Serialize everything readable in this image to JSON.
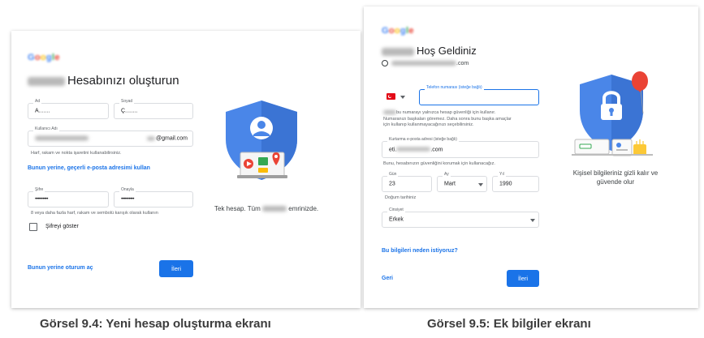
{
  "screen1": {
    "title": "Hesabınızı oluşturun",
    "first_name": {
      "label": "Ad",
      "value": "A......."
    },
    "last_name": {
      "label": "Soyad",
      "value": "Ç........"
    },
    "username": {
      "label": "Kullanıcı Adı",
      "suffix": "@gmail.com"
    },
    "username_hint": "Harf, rakam ve nokta işaretini kullanabilirsiniz.",
    "use_email_link": "Bunun yerine, geçerli e-posta adresimi kullan",
    "password": {
      "label": "Şifre",
      "value": "••••••••••"
    },
    "confirm": {
      "label": "Onayla",
      "value": "••••••••••"
    },
    "password_hint": "8 veya daha fazla harf, rakam ve sembolü karışık olarak kullanın",
    "show_password_label": "Şifreyi göster",
    "sign_in_link": "Bunun yerine oturum aç",
    "next_button": "İleri",
    "tagline_prefix": "Tek hesap. Tüm",
    "tagline_suffix": "emrinizde."
  },
  "screen2": {
    "title_suffix": "Hoş Geldiniz",
    "email_suffix": ".com",
    "phone": {
      "label": "Telefon numarası (isteğe bağlı)"
    },
    "phone_hint_lines": [
      "bu numarayı yalnızca hesap güvenliği için kullanır.",
      "Numaranızı başkaları göremez. Daha sonra bunu başka amaçlar",
      "için kullanıp kullanmayacağınızı seçebilirsiniz."
    ],
    "recovery": {
      "label": "Kurtarma e-posta adresi (isteğe bağlı)",
      "value_prefix": "eti.",
      "value_suffix": ".com"
    },
    "recovery_hint": "Bunu, hesabınızın güvenliğini korumak için kullanacağız.",
    "day": {
      "label": "Gün",
      "value": "23"
    },
    "month": {
      "label": "Ay",
      "value": "Mart"
    },
    "year": {
      "label": "Yıl",
      "value": "1990"
    },
    "birthday_label": "Doğum tarihiniz",
    "gender": {
      "label": "Cinsiyet",
      "value": "Erkek"
    },
    "why_link": "Bu bilgileri neden istiyoruz?",
    "back_link": "Geri",
    "next_button": "İleri",
    "privacy_text_line1": "Kişisel bilgileriniz gizli kalır ve",
    "privacy_text_line2": "güvende olur"
  },
  "captions": {
    "left": "Görsel 9.4: Yeni hesap oluşturma ekranı",
    "right": "Görsel 9.5: Ek bilgiler ekranı"
  },
  "colors": {
    "accent": "#1a73e8",
    "shield": "#4a86e8",
    "balloon": "#ea4335"
  }
}
